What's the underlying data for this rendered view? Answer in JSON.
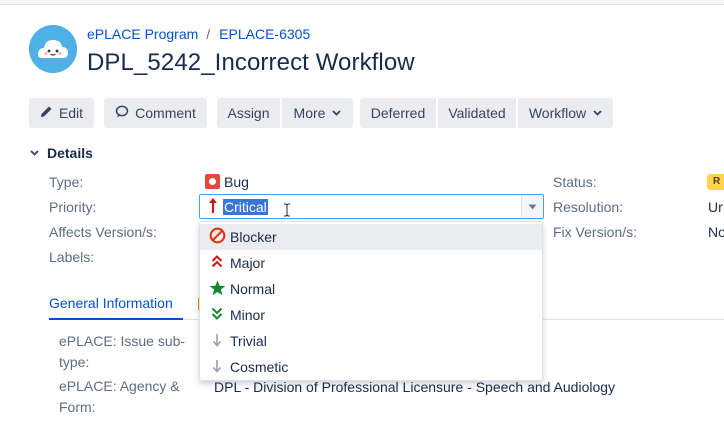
{
  "breadcrumb": {
    "project": "ePLACE Program",
    "separator": "/",
    "issue_key": "EPLACE-6305"
  },
  "issue": {
    "title": "DPL_5242_Incorrect Workflow"
  },
  "toolbar": {
    "edit": "Edit",
    "comment": "Comment",
    "assign": "Assign",
    "more": "More",
    "deferred": "Deferred",
    "validated": "Validated",
    "workflow": "Workflow"
  },
  "details": {
    "heading": "Details",
    "type_label": "Type:",
    "type_value": "Bug",
    "priority_label": "Priority:",
    "priority_value": "Critical",
    "affects_label": "Affects Version/s:",
    "labels_label": "Labels:",
    "status_label": "Status:",
    "status_badge": "R",
    "resolution_label": "Resolution:",
    "resolution_value": "Ur",
    "fix_label": "Fix Version/s:",
    "fix_value": "No"
  },
  "priority_options": [
    {
      "label": "Blocker",
      "icon": "blocker-icon",
      "color": "#de350b",
      "active": true
    },
    {
      "label": "Major",
      "icon": "double-chevron-up-icon",
      "color": "#cd1317"
    },
    {
      "label": "Normal",
      "icon": "star-icon",
      "color": "#14892c"
    },
    {
      "label": "Minor",
      "icon": "double-chevron-down-icon",
      "color": "#14892c"
    },
    {
      "label": "Trivial",
      "icon": "arrow-down-icon",
      "color": "#97a0af"
    },
    {
      "label": "Cosmetic",
      "icon": "arrow-down-icon",
      "color": "#97a0af"
    }
  ],
  "tabs": {
    "general": "General Information"
  },
  "general_info": {
    "subtype_label_1": "ePLACE: Issue sub-",
    "subtype_label_2": "type:",
    "agency_label_1": "ePLACE: Agency &",
    "agency_label_2": "Form:",
    "agency_value": "DPL - Division of Professional Licensure - Speech and Audiology"
  },
  "colors": {
    "link": "#0052cc",
    "accent_focus": "#4c9aff",
    "selection": "#3875d7",
    "status_badge": "#ffd351"
  }
}
